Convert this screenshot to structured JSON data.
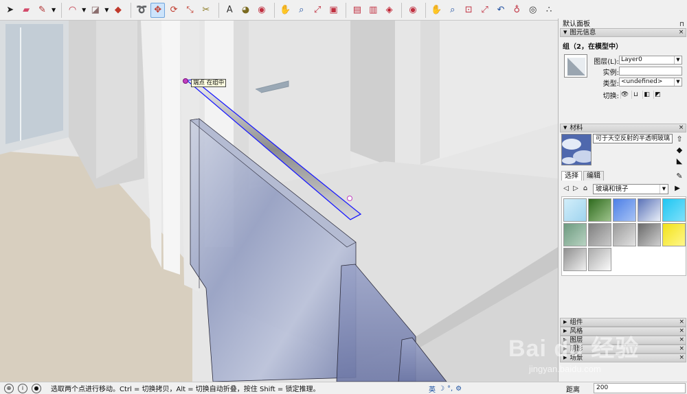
{
  "toolbar": {
    "tools": [
      {
        "name": "select-tool",
        "icon": "arrow-cursor-icon",
        "color": "#222222"
      },
      {
        "name": "eraser-tool",
        "icon": "eraser-icon",
        "color": "#d24a6a"
      },
      {
        "name": "line-tool",
        "icon": "pencil-icon",
        "color": "#b03030",
        "dropdown": true
      },
      {
        "name": "arc-tool",
        "icon": "arc-icon",
        "color": "#c03040",
        "dropdown": true
      },
      {
        "name": "rectangle-tool",
        "icon": "rectangle-icon",
        "color": "#8a6d6d",
        "dropdown": true
      },
      {
        "name": "push-pull-tool",
        "icon": "push-pull-icon",
        "color": "#c0392b"
      },
      {
        "name": "follow-me-tool",
        "icon": "follow-me-icon",
        "color": "#c0392b"
      },
      {
        "name": "move-tool",
        "icon": "move-icon",
        "color": "#c0392b",
        "active": true
      },
      {
        "name": "rotate-tool",
        "icon": "rotate-icon",
        "color": "#c0392b"
      },
      {
        "name": "scale-tool",
        "icon": "scale-icon",
        "color": "#c0392b"
      },
      {
        "name": "tape-measure-tool",
        "icon": "tape-measure-icon",
        "color": "#8a7a20"
      },
      {
        "name": "text-tool",
        "icon": "text-icon",
        "color": "#333333"
      },
      {
        "name": "paint-bucket-tool",
        "icon": "paint-bucket-icon",
        "color": "#7a6a20"
      },
      {
        "name": "orbit-tool",
        "icon": "orbit-icon",
        "color": "#c03040"
      },
      {
        "name": "pan-tool",
        "icon": "hand-icon",
        "color": "#c8a060"
      },
      {
        "name": "zoom-tool",
        "icon": "magnifier-icon",
        "color": "#1f4fa0"
      },
      {
        "name": "zoom-extents-tool",
        "icon": "zoom-extents-icon",
        "color": "#c03040"
      },
      {
        "name": "warehouse-tool",
        "icon": "warehouse-icon",
        "color": "#c03040"
      },
      {
        "name": "share-model-tool",
        "icon": "share-model-icon",
        "color": "#c03040"
      },
      {
        "name": "get-models-tool",
        "icon": "get-models-icon",
        "color": "#c03040"
      },
      {
        "name": "extension-warehouse-tool",
        "icon": "ruby-icon",
        "color": "#c02030"
      },
      {
        "name": "orbit-tool-2",
        "icon": "orbit-icon",
        "color": "#c03040"
      },
      {
        "name": "pan-tool-2",
        "icon": "hand-icon",
        "color": "#c8a060"
      },
      {
        "name": "zoom-tool-2",
        "icon": "magnifier-icon",
        "color": "#1f4fa0"
      },
      {
        "name": "zoom-window-tool",
        "icon": "zoom-window-icon",
        "color": "#c03040"
      },
      {
        "name": "zoom-extents-tool-2",
        "icon": "zoom-extents-icon",
        "color": "#c03040"
      },
      {
        "name": "previous-view-tool",
        "icon": "previous-view-icon",
        "color": "#1f4fa0"
      },
      {
        "name": "position-camera-tool",
        "icon": "position-camera-icon",
        "color": "#c03040"
      },
      {
        "name": "look-around-tool",
        "icon": "eye-icon",
        "color": "#333333"
      },
      {
        "name": "walk-tool",
        "icon": "footprints-icon",
        "color": "#333333"
      }
    ]
  },
  "viewport": {
    "tooltip": "端点 在组中"
  },
  "tray": {
    "title": "默认面板",
    "pin": "⊓",
    "entity_info": {
      "header": "图元信息",
      "title": "组（2，在模型中）",
      "layer_label": "图层(L):",
      "layer_value": "Layer0",
      "instance_label": "实例:",
      "instance_value": "",
      "type_label": "类型:",
      "type_value": "<undefined>",
      "toggle_label": "切换:"
    },
    "materials": {
      "header": "材料",
      "material_name": "可于天空反射的半透明玻璃",
      "tabs": [
        "选择",
        "编辑"
      ],
      "library": "玻璃和镜子",
      "swatches": [
        {
          "name": "swatch-light-cyan-grid",
          "c1": "#d2eefa",
          "c2": "#9fd4ef"
        },
        {
          "name": "swatch-green-diagonal",
          "c1": "#2f6b1e",
          "c2": "#9cc28a"
        },
        {
          "name": "swatch-blue-gradient",
          "c1": "#4d7fe6",
          "c2": "#a7c3f5"
        },
        {
          "name": "swatch-sky-reflection",
          "c1": "#5b73b8",
          "c2": "#e8eef8"
        },
        {
          "name": "swatch-cyan-diagonal",
          "c1": "#1fc6f2",
          "c2": "#7ee0fa"
        },
        {
          "name": "swatch-green-stripes",
          "c1": "#6d9a7f",
          "c2": "#b8d3c2"
        },
        {
          "name": "swatch-gray-grid",
          "c1": "#7f7f7f",
          "c2": "#c9c9c9"
        },
        {
          "name": "swatch-speckled",
          "c1": "#9a9a9a",
          "c2": "#e2e2e2"
        },
        {
          "name": "swatch-gray-diagonal",
          "c1": "#6a6a6a",
          "c2": "#cfcfcf"
        },
        {
          "name": "swatch-yellow",
          "c1": "#f2e21a",
          "c2": "#fff78a"
        },
        {
          "name": "swatch-gray-gradient",
          "c1": "#8f8f8f",
          "c2": "#f0f0f0"
        },
        {
          "name": "swatch-light-gray-gradient",
          "c1": "#aaaaaa",
          "c2": "#fbfbfb"
        }
      ]
    },
    "collapsed_panels": [
      {
        "name": "panel-components",
        "label": "组件"
      },
      {
        "name": "panel-styles",
        "label": "风格"
      },
      {
        "name": "panel-layers",
        "label": "图层"
      },
      {
        "name": "panel-shadows",
        "label": "阴影"
      },
      {
        "name": "panel-scenes",
        "label": "场景"
      }
    ]
  },
  "status": {
    "message": "选取两个点进行移动。Ctrl = 切换拷贝，Alt = 切换自动折叠，按住 Shift = 锁定推理。",
    "ime": "英",
    "vcb_label": "距离",
    "vcb_value": "200"
  },
  "watermark": {
    "logo": "Bai du 经验",
    "url": "jingyan.baidu.com"
  }
}
